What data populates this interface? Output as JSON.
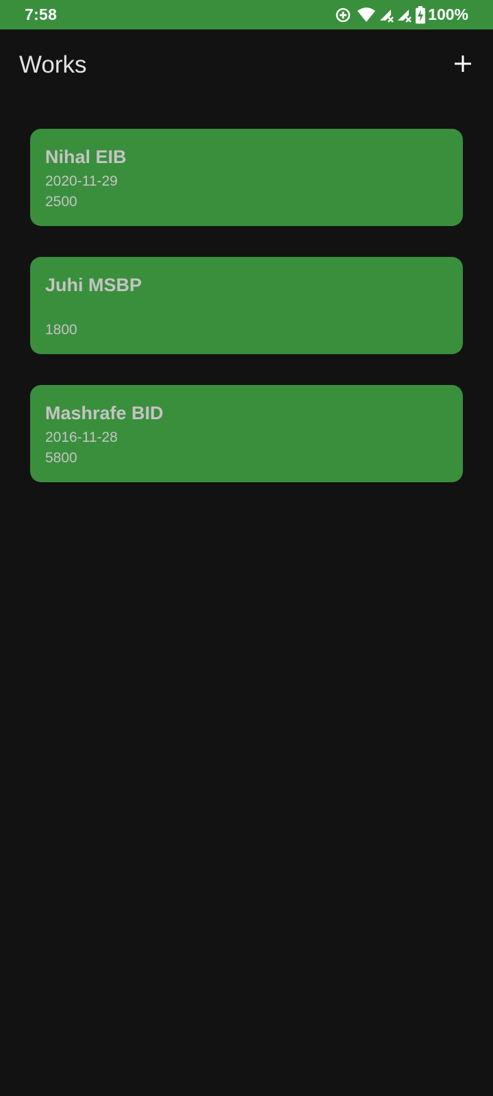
{
  "status_bar": {
    "time": "7:58",
    "battery": "100%",
    "icons": [
      "sync-add-icon",
      "wifi-icon",
      "signal-no-service-icon",
      "signal-no-service-icon",
      "battery-charging-icon"
    ]
  },
  "app_bar": {
    "title": "Works",
    "add_icon": "plus-icon"
  },
  "works": [
    {
      "name": "Nihal EIB",
      "date": "2020-11-29",
      "amount": "2500"
    },
    {
      "name": "Juhi MSBP",
      "date": "",
      "amount": "1800"
    },
    {
      "name": "Mashrafe BID",
      "date": "2016-11-28",
      "amount": "5800"
    }
  ],
  "colors": {
    "primary": "#3a8f3d",
    "background": "#121212",
    "card_text": "#c4c4c4",
    "title_text": "#e3e3e3"
  }
}
